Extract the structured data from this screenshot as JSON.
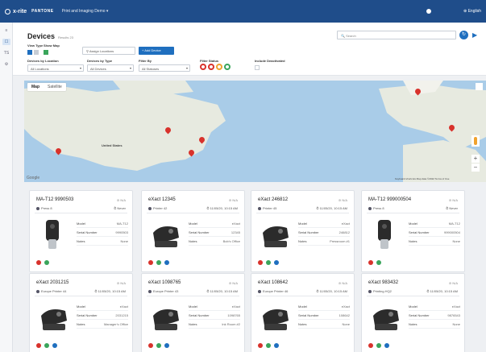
{
  "topbar": {
    "brand": "x-rite",
    "pantone": "PANTONE",
    "app_title": "Print and Imaging Demo",
    "language": "English"
  },
  "rail": [
    "≡",
    "☐",
    "TS",
    "⚙"
  ],
  "header": {
    "title": "Devices",
    "result_count": "Results 23",
    "search_placeholder": "Search",
    "view_type_label": "View Type",
    "show_map_label": "Show Map",
    "assign_label": "Assign Locations",
    "add_device_label": "Add Device",
    "filters": [
      {
        "label": "Devices by Location",
        "value": "All Locations"
      },
      {
        "label": "Devices by Type",
        "value": "All Devices"
      },
      {
        "label": "Filter By",
        "value": "All Statuses"
      }
    ],
    "filter_status_label": "Filter Status",
    "include_deactivated_label": "Include Deactivated"
  },
  "map": {
    "tabs": [
      "Map",
      "Satellite"
    ],
    "active_tab": "Map",
    "country_label": "United States",
    "google": "Google",
    "terms": "Keyboard shortcuts   Map data ©2022   Terms of Use"
  },
  "colors": {
    "topbar": "#1f4d8a",
    "accent": "#1f6fbf",
    "pin": "#d8322c",
    "status_red": "#d8322c",
    "status_orange": "#f0a22e",
    "status_green": "#3aa55b"
  },
  "cards": [
    {
      "name": "MA-T12 9990503",
      "status": "N/A",
      "location": "Press 8",
      "date": "Never",
      "fields": [
        [
          "Model",
          "MA-T12"
        ],
        [
          "Serial Number",
          "9990503"
        ],
        [
          "Notes",
          "None"
        ]
      ],
      "device": "ma-icon",
      "actions": 2
    },
    {
      "name": "eXact 12345",
      "status": "N/A",
      "location": "Printer 42",
      "date": "11/05/20, 10:15 AM",
      "fields": [
        [
          "Model",
          "eXact"
        ],
        [
          "Serial Number",
          "12345"
        ],
        [
          "Notes",
          "Bob's Office"
        ]
      ],
      "device": "exact-icon",
      "actions": 3
    },
    {
      "name": "eXact 246812",
      "status": "N/A",
      "location": "Printer 45",
      "date": "11/05/20, 10:15 AM",
      "fields": [
        [
          "Model",
          "eXact"
        ],
        [
          "Serial Number",
          "246812"
        ],
        [
          "Notes",
          "Pressroom #1"
        ]
      ],
      "device": "exact-icon",
      "actions": 3
    },
    {
      "name": "MA-T12 999000504",
      "status": "N/A",
      "location": "Press 8",
      "date": "Never",
      "fields": [
        [
          "Model",
          "MA-T12"
        ],
        [
          "Serial Number",
          "999000504"
        ],
        [
          "Notes",
          "None"
        ]
      ],
      "device": "ma-icon",
      "actions": 2
    },
    {
      "name": "eXact 2031215",
      "status": "N/A",
      "location": "Europe Printer 44",
      "date": "11/05/20, 10:15 AM",
      "fields": [
        [
          "Model",
          "eXact"
        ],
        [
          "Serial Number",
          "2031215"
        ],
        [
          "Notes",
          "Manager's Office"
        ]
      ],
      "device": "exact-icon",
      "actions": 3
    },
    {
      "name": "eXact 1098765",
      "status": "N/A",
      "location": "Europe Printer 43",
      "date": "11/05/20, 10:15 AM",
      "fields": [
        [
          "Model",
          "eXact"
        ],
        [
          "Serial Number",
          "1098765"
        ],
        [
          "Notes",
          "Ink Room #2"
        ]
      ],
      "device": "exact-icon",
      "actions": 3
    },
    {
      "name": "eXact 108642",
      "status": "N/A",
      "location": "Europe Printer 46",
      "date": "11/05/20, 10:15 AM",
      "fields": [
        [
          "Model",
          "eXact"
        ],
        [
          "Serial Number",
          "108642"
        ],
        [
          "Notes",
          "None"
        ]
      ],
      "device": "exact-icon",
      "actions": 3
    },
    {
      "name": "eXact 983432",
      "status": "N/A",
      "location": "Printing HQ2",
      "date": "11/05/20, 10:15 AM",
      "fields": [
        [
          "Model",
          "eXact"
        ],
        [
          "Serial Number",
          "9876543"
        ],
        [
          "Notes",
          "None"
        ]
      ],
      "device": "exact-icon",
      "actions": 3
    }
  ]
}
